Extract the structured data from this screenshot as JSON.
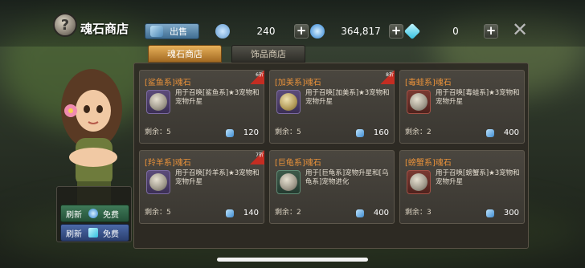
{
  "header": {
    "title": "魂石商店",
    "shop_icon_glyph": "?",
    "sell_label": "出售",
    "close_glyph": "✕"
  },
  "currencies": [
    {
      "name": "soul-stone",
      "value": "240",
      "color": "#7fb7e6"
    },
    {
      "name": "crystal",
      "value": "364,817",
      "color": "#3f9be6"
    },
    {
      "name": "diamond",
      "value": "0",
      "color": "#6de0f0"
    }
  ],
  "tabs": [
    {
      "label": "魂石商店",
      "active": true
    },
    {
      "label": "饰品商店",
      "active": false
    }
  ],
  "items": [
    {
      "title": "[鲨鱼系]魂石",
      "desc": "用于召唤[鲨鱼系]★3宠物和宠物升星",
      "remain": "剩余：5",
      "price": "120",
      "discount": "6折"
    },
    {
      "title": "[加美系]魂石",
      "desc": "用于召唤[加美系]★3宠物和宠物升星",
      "remain": "剩余：5",
      "price": "160",
      "discount": "8折"
    },
    {
      "title": "[毒蛙系]魂石",
      "desc": "用于召唤[毒蛙系]★3宠物和宠物升星",
      "remain": "剩余：2",
      "price": "400",
      "discount": ""
    },
    {
      "title": "[羚羊系]魂石",
      "desc": "用于召唤[羚羊系]★3宠物和宠物升星",
      "remain": "剩余：5",
      "price": "140",
      "discount": "7折"
    },
    {
      "title": "[巨龟系]魂石",
      "desc": "用于[巨龟系]宠物升星和[乌龟系]宠物进化",
      "remain": "剩余：2",
      "price": "400",
      "discount": ""
    },
    {
      "title": "[螃蟹系]魂石",
      "desc": "用于召唤[螃蟹系]★3宠物和宠物升星",
      "remain": "剩余：3",
      "price": "300",
      "discount": ""
    }
  ],
  "refresh": [
    {
      "label": "刷新",
      "cost": "免费",
      "icon": "crystal-icon"
    },
    {
      "label": "刷新",
      "cost": "免费",
      "icon": "diamond-icon"
    }
  ],
  "colors": {
    "accent": "#e8913a",
    "badge": "#c42d22"
  }
}
